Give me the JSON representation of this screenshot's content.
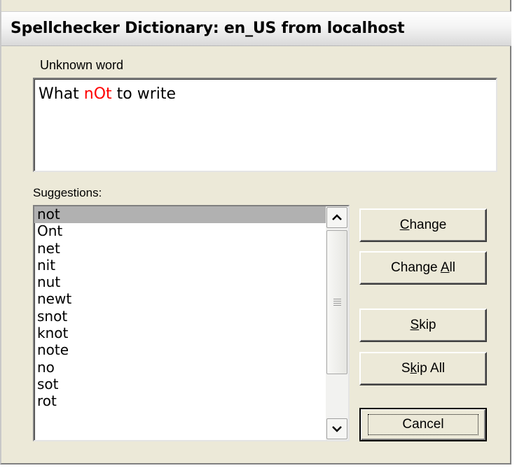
{
  "window": {
    "title": "Spellchecker Dictionary: en_US from localhost"
  },
  "unknown_word": {
    "label": "Unknown word",
    "sentence_before": "What ",
    "misspelled": "nOt",
    "sentence_after": " to write",
    "misspelled_color": "#ff0000"
  },
  "suggestions": {
    "label": "Suggestions:",
    "selected_index": 0,
    "items": [
      "not",
      "Ont",
      "net",
      "nit",
      "nut",
      "newt",
      "snot",
      "knot",
      "note",
      "no",
      "sot",
      "rot"
    ]
  },
  "buttons": {
    "change": {
      "pre": "",
      "mnemonic": "C",
      "post": "hange"
    },
    "change_all": {
      "pre": "Change ",
      "mnemonic": "A",
      "post": "ll"
    },
    "skip": {
      "pre": "",
      "mnemonic": "S",
      "post": "kip"
    },
    "skip_all": {
      "pre": "S",
      "mnemonic": "k",
      "post": "ip All"
    },
    "cancel": {
      "label": "Cancel"
    }
  },
  "icons": {
    "scroll_up": "chevron-up-icon",
    "scroll_down": "chevron-down-icon"
  }
}
